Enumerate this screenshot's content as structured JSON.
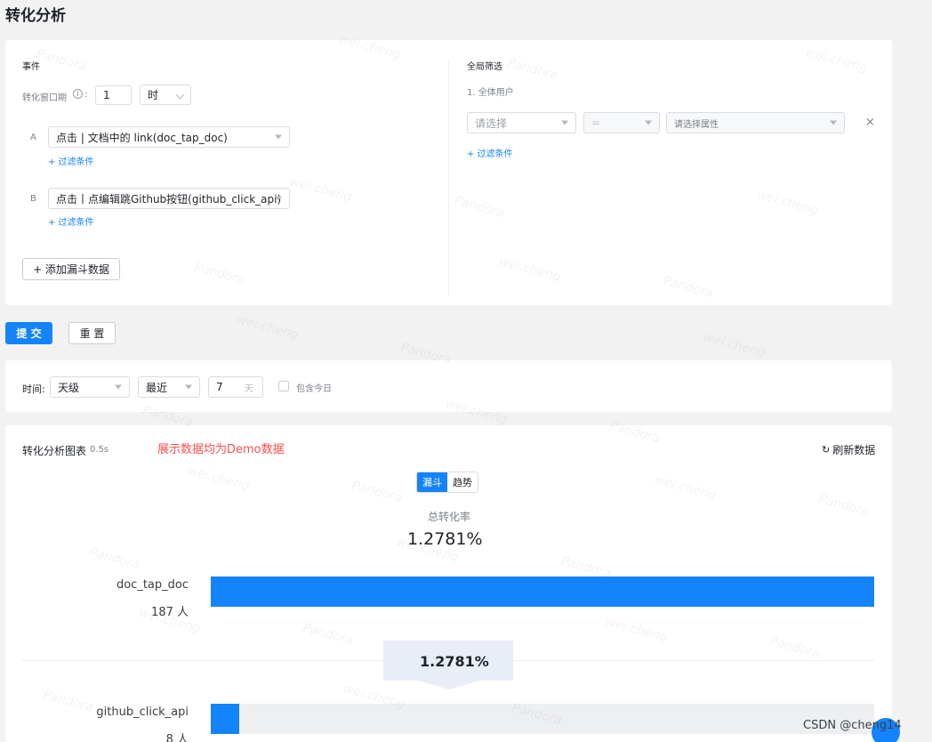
{
  "page": {
    "title": "转化分析"
  },
  "events": {
    "section_label": "事件",
    "window_label": "转化窗口期",
    "window_value": "1",
    "window_unit": "时",
    "steps": [
      {
        "letter": "A",
        "event": "点击 | 文档中的 link(doc_tap_doc)",
        "filter": "+ 过滤条件"
      },
      {
        "letter": "B",
        "event": "点击丨点编辑跳Github按钮(github_click_api)",
        "filter": "+ 过滤条件"
      }
    ],
    "add_button": "+ 添加漏斗数据"
  },
  "global_filter": {
    "label": "全局筛选",
    "group": "1. 全体用户",
    "select_placeholder": "请选择",
    "operator": "=",
    "attr_placeholder": "请选择属性",
    "close": "×",
    "add_filter": "+ 过滤条件"
  },
  "actions": {
    "submit": "提 交",
    "reset": "重 置"
  },
  "time_bar": {
    "label": "时间:",
    "granularity": "天级",
    "range_mode": "最近",
    "range_value": "7",
    "range_unit": "天",
    "include_today": "包含今日"
  },
  "chart_card": {
    "title": "转化分析图表",
    "elapsed": "0.5s",
    "demo_note": "展示数据均为Demo数据",
    "refresh": "刷新数据",
    "tabs": {
      "funnel": "漏斗",
      "trend": "趋势"
    },
    "total_label": "总转化率",
    "total_value": "1.2781%"
  },
  "chart_data": {
    "type": "bar",
    "categories": [
      "doc_tap_doc",
      "github_click_api"
    ],
    "series": [
      {
        "values": [
          1.0,
          0.012781
        ]
      }
    ],
    "user_counts": [
      "187 人",
      "8 人"
    ],
    "step_conversion": "1.2781%"
  },
  "footer": {
    "credit": "CSDN @cheng14"
  },
  "watermarks": [
    "wei.cheng",
    "Pandora"
  ],
  "colors": {
    "accent": "#1484fc",
    "note": "#ff4d4f"
  }
}
